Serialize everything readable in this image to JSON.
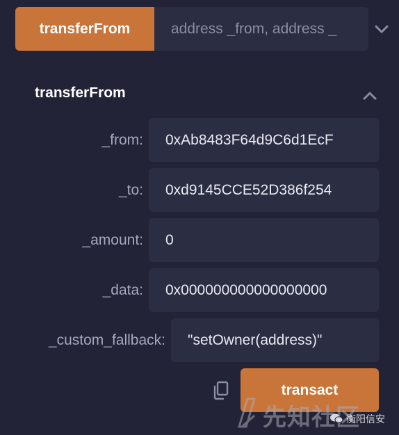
{
  "top": {
    "button_label": "transferFrom",
    "input_placeholder": "address _from, address _"
  },
  "section": {
    "title": "transferFrom"
  },
  "fields": [
    {
      "label": "_from:",
      "value": "0xAb8483F64d9C6d1EcF"
    },
    {
      "label": "_to:",
      "value": "0xd9145CCE52D386f254"
    },
    {
      "label": "_amount:",
      "value": "0"
    },
    {
      "label": "_data:",
      "value": "0x000000000000000000"
    },
    {
      "label": "_custom_fallback:",
      "value": "\"setOwner(address)\""
    }
  ],
  "actions": {
    "transact_label": "transact"
  },
  "watermark": {
    "site_text": "先知社区",
    "wechat_text": "衡阳信安"
  },
  "icons": {
    "expand": "chevron-down-icon",
    "collapse": "chevron-up-icon",
    "copy": "copy-icon"
  },
  "colors": {
    "background": "#222336",
    "accent": "#c97539",
    "input_bg": "#2b2d42"
  }
}
